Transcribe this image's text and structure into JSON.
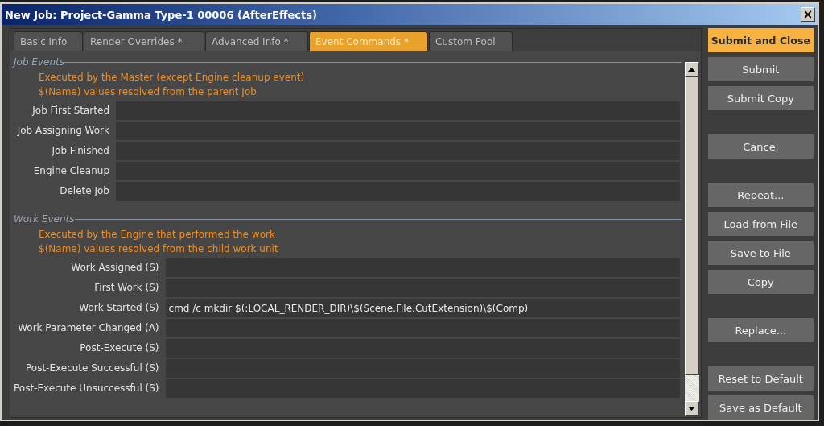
{
  "window": {
    "title": "New Job: Project-Gamma Type-1 00006 (AfterEffects)",
    "close": "×"
  },
  "tabs": [
    {
      "label": "Basic Info",
      "selected": false
    },
    {
      "label": "Render Overrides *",
      "selected": false
    },
    {
      "label": "Advanced Info *",
      "selected": false
    },
    {
      "label": "Event Commands *",
      "selected": true
    },
    {
      "label": "Custom Pool",
      "selected": false
    }
  ],
  "sections": [
    {
      "title": "Job Events",
      "notes": [
        "Executed by the Master (except Engine cleanup event)",
        "$(Name) values resolved from the parent Job"
      ],
      "fields": [
        {
          "label": "Job First Started"
        },
        {
          "label": "Job Assigning Work"
        },
        {
          "label": "Job Finished"
        },
        {
          "label": "Engine Cleanup"
        },
        {
          "label": "Delete Job"
        }
      ]
    },
    {
      "title": "Work Events",
      "notes": [
        "Executed by the Engine that performed the work",
        "$(Name) values resolved from the child work unit"
      ],
      "fields": [
        {
          "label": "Work Assigned (S)"
        },
        {
          "label": "First Work (S)"
        },
        {
          "label": "Work Started (S)",
          "value": "cmd /c mkdir $(:LOCAL_RENDER_DIR)\\$(Scene.File.CutExtension)\\$(Comp)"
        },
        {
          "label": "Work Parameter Changed (A)"
        },
        {
          "label": "Post-Execute (S)"
        },
        {
          "label": "Post-Execute Successful (S)"
        },
        {
          "label": "Post-Execute Unsuccessful (S)"
        }
      ]
    }
  ],
  "button_groups": [
    [
      {
        "label": "Submit and Close",
        "kind": "primary"
      },
      {
        "label": "Submit",
        "kind": "normal"
      },
      {
        "label": "Submit Copy",
        "kind": "normal"
      }
    ],
    [
      {
        "label": "Cancel",
        "kind": "normal"
      }
    ],
    [
      {
        "label": "Repeat...",
        "kind": "normal"
      },
      {
        "label": "Load from File",
        "kind": "normal"
      },
      {
        "label": "Save to File",
        "kind": "normal"
      },
      {
        "label": "Copy",
        "kind": "normal"
      }
    ],
    [
      {
        "label": "Replace...",
        "kind": "normal"
      }
    ],
    [
      {
        "label": "Reset to Default",
        "kind": "normal"
      },
      {
        "label": "Save as Default",
        "kind": "normal"
      }
    ]
  ]
}
